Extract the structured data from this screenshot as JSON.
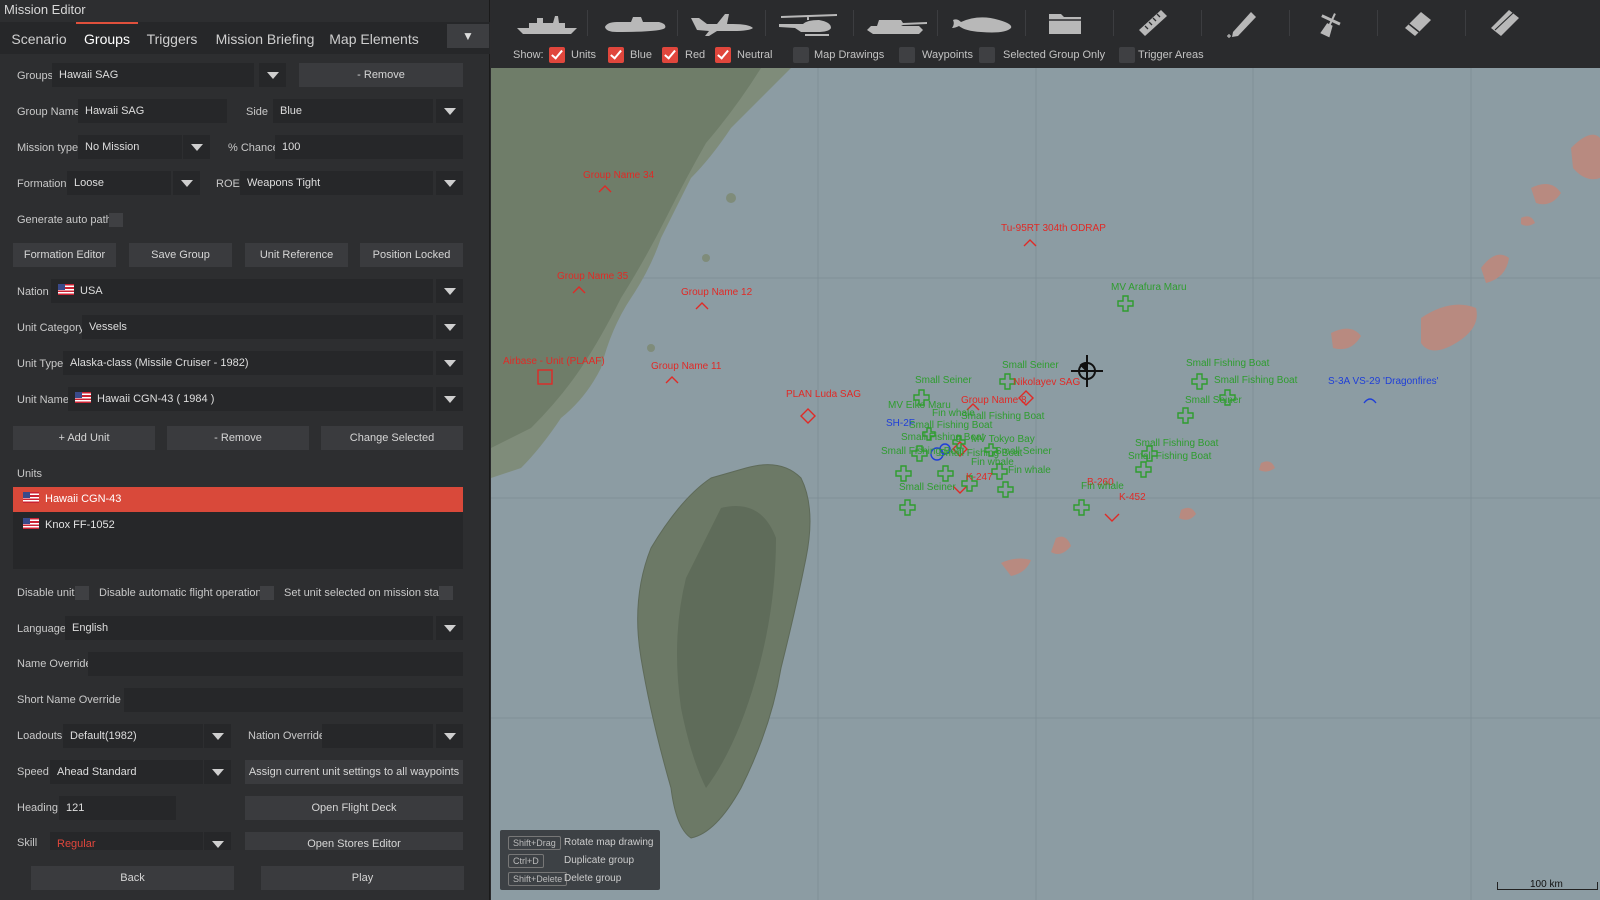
{
  "window_title": "Mission Editor",
  "tabs": [
    "Scenario",
    "Groups",
    "Triggers",
    "Mission Briefing",
    "Map Elements"
  ],
  "form": {
    "groups_label": "Groups",
    "groups_value": "Hawaii SAG",
    "remove_group": "- Remove",
    "group_name_label": "Group Name",
    "group_name_value": "Hawaii SAG",
    "side_label": "Side",
    "side_value": "Blue",
    "mission_type_label": "Mission type",
    "mission_type_value": "No Mission",
    "chance_label": "% Chance",
    "chance_value": "100",
    "formation_label": "Formation",
    "formation_value": "Loose",
    "roe_label": "ROE",
    "roe_value": "Weapons Tight",
    "auto_path_label": "Generate auto path",
    "formation_editor": "Formation Editor",
    "save_group": "Save Group",
    "unit_reference": "Unit Reference",
    "position_locked": "Position Locked",
    "nation_label": "Nation",
    "nation_value": "USA",
    "unit_category_label": "Unit Category",
    "unit_category_value": "Vessels",
    "unit_type_label": "Unit Type",
    "unit_type_value": "Alaska-class (Missile Cruiser - 1982)",
    "unit_name_label": "Unit Name",
    "unit_name_value": "Hawaii CGN-43 ( 1984 )",
    "add_unit": "+ Add Unit",
    "remove_unit": "- Remove",
    "change_selected": "Change Selected",
    "units_label": "Units",
    "units": [
      "Hawaii CGN-43",
      "Knox FF-1052"
    ],
    "disable_unit": "Disable unit",
    "disable_flight_ops": "Disable automatic flight operations",
    "set_selected": "Set unit selected on mission start",
    "language_label": "Language",
    "language_value": "English",
    "name_override_label": "Name Override",
    "short_name_override_label": "Short Name Override",
    "loadouts_label": "Loadouts",
    "loadouts_value": "Default(1982)",
    "nation_override_label": "Nation Override",
    "speed_label": "Speed",
    "speed_value": "Ahead Standard",
    "assign_settings": "Assign current unit settings to all waypoints",
    "heading_label": "Heading",
    "heading_value": "121",
    "open_flight_deck": "Open Flight Deck",
    "skill_label": "Skill",
    "skill_value": "Regular",
    "open_stores": "Open Stores Editor",
    "back": "Back",
    "play": "Play"
  },
  "toolbar": {
    "tools": [
      "ship-tool",
      "submarine-tool",
      "aircraft-tool",
      "helicopter-tool",
      "tank-tool",
      "facility-tool",
      "folder-tool",
      "ruler-tool",
      "pencil-tool",
      "satellite-tool",
      "eraser-tool",
      "clear-tool"
    ],
    "show_label": "Show:",
    "filters": [
      {
        "label": "Units",
        "on": true
      },
      {
        "label": "Blue",
        "on": true
      },
      {
        "label": "Red",
        "on": true
      },
      {
        "label": "Neutral",
        "on": true
      },
      {
        "label": "Map Drawings",
        "on": false
      },
      {
        "label": "Waypoints",
        "on": false
      },
      {
        "label": "Selected Group Only",
        "on": false
      },
      {
        "label": "Trigger Areas",
        "on": false
      }
    ]
  },
  "map_labels": {
    "red": [
      "Group Name 34",
      "Tu-95RT 304th ODRAP",
      "Group Name 35",
      "Group Name 12",
      "Airbase - Unit (PLAAF)",
      "Group Name 11",
      "PLAN Luda SAG",
      "Nikolayev SAG",
      "Group Name 8",
      "K-247",
      "B-260",
      "K-452"
    ],
    "green": [
      "MV Arafura Maru",
      "Small Seiner",
      "Small Seiner",
      "Small Fishing Boat",
      "Small Fishing Boat",
      "Small Seiner",
      "MV Eiko Maru",
      "Fin whale",
      "Small Fishing Boat",
      "Small Fishing Boat",
      "Small Fishing Boat",
      "MV Tokyo Bay",
      "Small Fishing Boat",
      "Small Fishing Boat",
      "Small Seiner",
      "Fin whale",
      "Fin whale",
      "Small Seiner",
      "Fin whale",
      "Small Fishing Boat",
      "Small Fishing Boat"
    ],
    "blue": [
      "SH-2F",
      "S-3A VS-29 'Dragonfires'"
    ]
  },
  "hints": [
    {
      "key": "Shift+Drag",
      "desc": "Rotate map drawing"
    },
    {
      "key": "Ctrl+D",
      "desc": "Duplicate group"
    },
    {
      "key": "Shift+Delete",
      "desc": "Delete group"
    }
  ],
  "scale_label": "100 km"
}
